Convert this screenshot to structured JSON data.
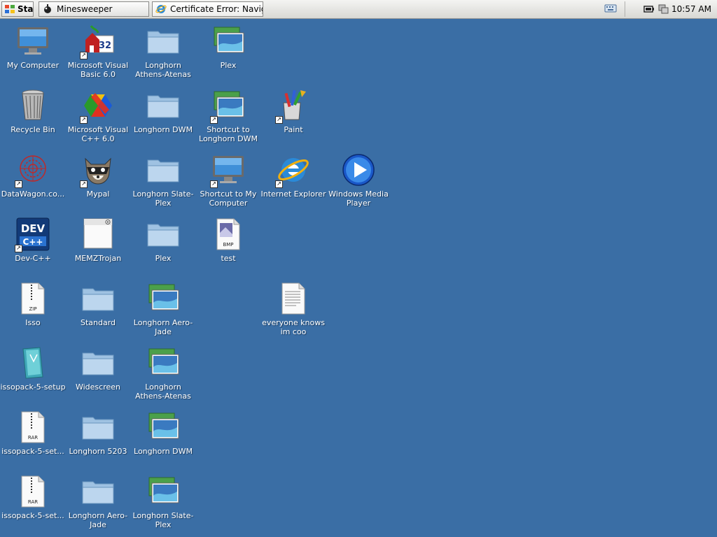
{
  "taskbar": {
    "start_label": "Start",
    "tasks": [
      {
        "label": "Minesweeper",
        "icon": "minesweeper-icon"
      },
      {
        "label": "Certificate Error: Naviga...",
        "icon": "internet-explorer-icon"
      }
    ],
    "tray": {
      "clock": "10:57 AM",
      "icons": [
        "keyboard-icon",
        "battery-icon",
        "network-icon"
      ]
    }
  },
  "desktop": {
    "icons": [
      {
        "label": "My Computer",
        "icon": "computer-icon",
        "shortcut": false
      },
      {
        "label": "Recycle Bin",
        "icon": "recycle-bin-icon",
        "shortcut": false
      },
      {
        "label": "DataWagon.co...",
        "icon": "datawagon-icon",
        "shortcut": true
      },
      {
        "label": "Dev-C++",
        "icon": "dev-cpp-icon",
        "shortcut": true
      },
      {
        "label": "Isso",
        "icon": "zip-file-icon",
        "shortcut": false
      },
      {
        "label": "issopack-5-setup",
        "icon": "installer-icon",
        "shortcut": false
      },
      {
        "label": "issopack-5-set...",
        "icon": "rar-file-icon",
        "shortcut": false
      },
      {
        "label": "issopack-5-set...",
        "icon": "rar-file-icon",
        "shortcut": false
      },
      {
        "label": "Microsoft Visual Basic 6.0",
        "icon": "visual-basic-icon",
        "shortcut": true
      },
      {
        "label": "Microsoft Visual C++ 6.0",
        "icon": "visual-cpp-icon",
        "shortcut": true
      },
      {
        "label": "Mypal",
        "icon": "mypal-raccoon-icon",
        "shortcut": true
      },
      {
        "label": "MEMZTrojan",
        "icon": "app-window-icon",
        "shortcut": false
      },
      {
        "label": "Standard",
        "icon": "folder-icon",
        "shortcut": false
      },
      {
        "label": "Widescreen",
        "icon": "folder-icon",
        "shortcut": false
      },
      {
        "label": "Longhorn 5203",
        "icon": "folder-icon",
        "shortcut": false
      },
      {
        "label": "Longhorn Aero-Jade",
        "icon": "folder-icon",
        "shortcut": false
      },
      {
        "label": "Longhorn Athens-Atenas",
        "icon": "folder-icon",
        "shortcut": false
      },
      {
        "label": "Longhorn DWM",
        "icon": "folder-icon",
        "shortcut": false
      },
      {
        "label": "Longhorn Slate-Plex",
        "icon": "folder-icon",
        "shortcut": false
      },
      {
        "label": "Plex",
        "icon": "folder-icon",
        "shortcut": false
      },
      {
        "label": "Longhorn Aero-Jade",
        "icon": "theme-pictures-icon",
        "shortcut": false
      },
      {
        "label": "Longhorn Athens-Atenas",
        "icon": "theme-pictures-icon",
        "shortcut": false
      },
      {
        "label": "Longhorn DWM",
        "icon": "theme-pictures-icon",
        "shortcut": false
      },
      {
        "label": "Longhorn Slate-Plex",
        "icon": "theme-pictures-icon",
        "shortcut": false
      },
      {
        "label": "Plex",
        "icon": "theme-pictures-icon",
        "shortcut": false
      },
      {
        "label": "Shortcut to Longhorn DWM",
        "icon": "theme-pictures-icon",
        "shortcut": true
      },
      {
        "label": "Shortcut to My Computer",
        "icon": "computer-icon",
        "shortcut": true
      },
      {
        "label": "test",
        "icon": "bmp-file-icon",
        "shortcut": false
      },
      {
        "label": "Paint",
        "icon": "paint-icon",
        "shortcut": true
      },
      {
        "label": "Internet Explorer",
        "icon": "internet-explorer-icon",
        "shortcut": true
      },
      {
        "label": "everyone knows im coo",
        "icon": "text-document-icon",
        "shortcut": false
      },
      {
        "label": "Windows Media Player",
        "icon": "media-player-icon",
        "shortcut": false
      }
    ]
  },
  "colors": {
    "desktop_background": "#3a6ea5",
    "taskbar": "#e8e8e6",
    "label_text": "#ffffff"
  }
}
